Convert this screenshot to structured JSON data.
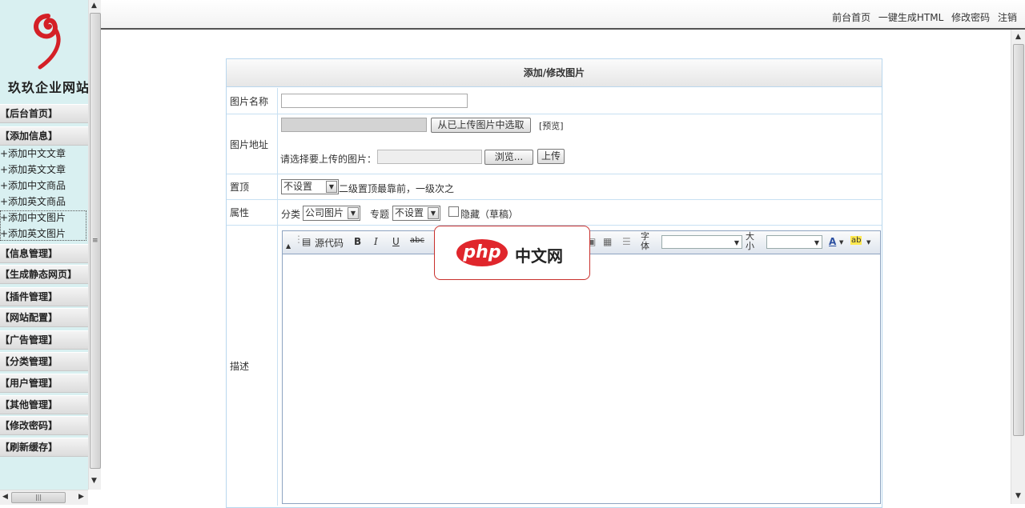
{
  "sidebar": {
    "logo_text": "玖玖企业网站",
    "menu": [
      {
        "label": "【后台首页】"
      },
      {
        "label": "【添加信息】"
      },
      {
        "label": "【信息管理】"
      },
      {
        "label": "【生成静态网页】"
      },
      {
        "label": "【插件管理】"
      },
      {
        "label": "【网站配置】"
      },
      {
        "label": "【广告管理】"
      },
      {
        "label": "【分类管理】"
      },
      {
        "label": "【用户管理】"
      },
      {
        "label": "【其他管理】"
      },
      {
        "label": "【修改密码】"
      },
      {
        "label": "【刷新缓存】"
      }
    ],
    "sub_items": [
      "+添加中文文章",
      "+添加英文文章",
      "+添加中文商品",
      "+添加英文商品",
      "+添加中文图片",
      "+添加英文图片"
    ]
  },
  "topbar": {
    "links": [
      "前台首页",
      "一键生成HTML",
      "修改密码",
      "注销"
    ]
  },
  "form": {
    "title": "添加/修改图片",
    "name_label": "图片名称",
    "name_value": "",
    "address_label": "图片地址",
    "address_value": "",
    "select_uploaded_button": "从已上传图片中选取",
    "preview_link": "[预览]",
    "upload_prompt": "请选择要上传的图片：",
    "browse_button": "浏览...",
    "upload_button": "上传",
    "top_label": "置顶",
    "top_select_value": "不设置",
    "top_hint": "二级置顶最靠前，一级次之",
    "attr_label": "属性",
    "category_label": "分类",
    "category_value": "公司图片",
    "topic_label": "专题",
    "topic_value": "不设置",
    "hidden_label": "隐藏（草稿）",
    "desc_label": "描述"
  },
  "editor": {
    "source_label": "源代码",
    "bold": "B",
    "italic": "I",
    "underline": "U",
    "strike": "abc",
    "font_label": "字体",
    "size_label": "大小",
    "font_value": "",
    "size_value": "",
    "font_color_icon": "A",
    "highlight_icon": "ab"
  },
  "watermark": {
    "brand": "php",
    "text": "中文网"
  },
  "scrollbar": {
    "left_grip": "|||",
    "mid_grip": "≡"
  }
}
